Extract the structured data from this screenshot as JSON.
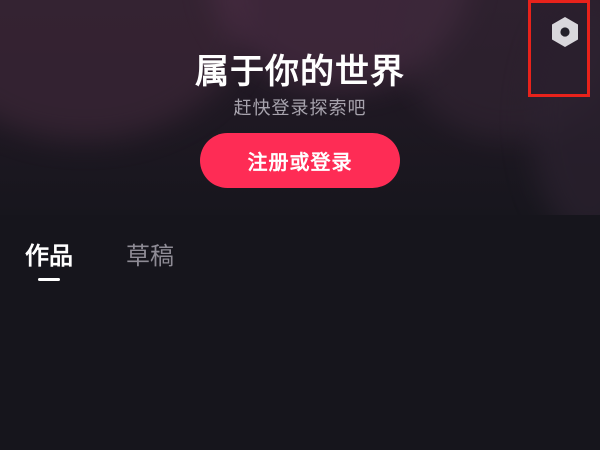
{
  "header": {
    "title": "属于你的世界",
    "subtitle": "赶快登录探索吧",
    "login_button": "注册或登录",
    "settings_icon": "hexagon-settings-icon"
  },
  "tabs": [
    {
      "label": "作品",
      "active": true
    },
    {
      "label": "草稿",
      "active": false
    }
  ],
  "colors": {
    "accent": "#fe2c55",
    "background": "#16151c",
    "highlight_frame": "#e8221b",
    "subtitle_text": "#a7a3ad",
    "inactive_tab": "#8e8b95"
  }
}
